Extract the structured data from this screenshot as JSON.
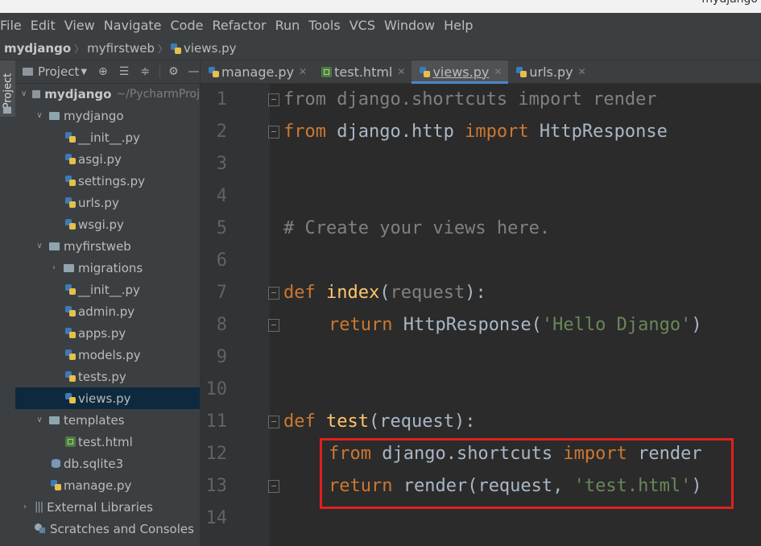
{
  "window": {
    "title": "mydjango"
  },
  "menu": [
    "File",
    "Edit",
    "View",
    "Navigate",
    "Code",
    "Refactor",
    "Run",
    "Tools",
    "VCS",
    "Window",
    "Help"
  ],
  "breadcrumb": [
    "mydjango",
    "myfirstweb",
    "views.py"
  ],
  "left_tool": {
    "project_tab": "Project"
  },
  "project_panel": {
    "header_label": "Project",
    "tree": {
      "root": {
        "name": "mydjango",
        "path": "~/PycharmProj"
      },
      "mydjango_pkg": {
        "name": "mydjango",
        "files": [
          "__init__.py",
          "asgi.py",
          "settings.py",
          "urls.py",
          "wsgi.py"
        ]
      },
      "myfirstweb": {
        "name": "myfirstweb",
        "migrations": "migrations",
        "files": [
          "__init__.py",
          "admin.py",
          "apps.py",
          "models.py",
          "tests.py",
          "views.py"
        ]
      },
      "templates": {
        "name": "templates",
        "files": [
          "test.html"
        ]
      },
      "root_files": [
        "db.sqlite3",
        "manage.py"
      ],
      "external": "External Libraries",
      "scratches": "Scratches and Consoles"
    }
  },
  "tabs": [
    {
      "label": "manage.py",
      "icon": "python-file-icon",
      "active": false
    },
    {
      "label": "test.html",
      "icon": "html-file-icon",
      "active": false
    },
    {
      "label": "views.py",
      "icon": "python-file-icon",
      "active": true
    },
    {
      "label": "urls.py",
      "icon": "python-file-icon",
      "active": false
    }
  ],
  "editor": {
    "line_numbers": [
      "1",
      "2",
      "3",
      "4",
      "5",
      "6",
      "7",
      "8",
      "9",
      "10",
      "11",
      "12",
      "13",
      "14"
    ],
    "lines": {
      "l1": {
        "a": "from",
        "b": " django.shortcuts ",
        "c": "import",
        "d": " render"
      },
      "l2": {
        "a": "from",
        "b": " django.http ",
        "c": "import",
        "d": " HttpResponse"
      },
      "l5": "# Create your views here.",
      "l7": {
        "a": "def",
        "b": " ",
        "c": "index",
        "d": "(",
        "e": "request",
        "f": "):"
      },
      "l8": {
        "a": "return",
        "b": " HttpResponse(",
        "c": "'Hello Django'",
        "d": ")"
      },
      "l11": {
        "a": "def",
        "b": " ",
        "c": "test",
        "d": "(request):"
      },
      "l12": {
        "a": "from",
        "b": " django.shortcuts ",
        "c": "import",
        "d": " render"
      },
      "l13": {
        "a": "return",
        "b": " render(request, ",
        "c": "'test.html'",
        "d": ")"
      }
    }
  },
  "colors": {
    "highlight_box": "#e02020",
    "keyword": "#cc7832",
    "string": "#6a8759",
    "function": "#ffc66d"
  }
}
